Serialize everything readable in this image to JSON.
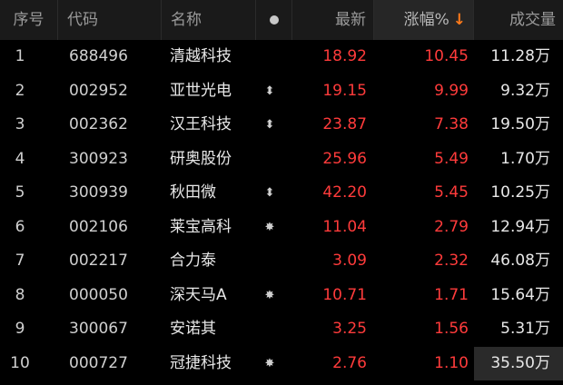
{
  "headers": {
    "index": "序号",
    "code": "代码",
    "name": "名称",
    "latest": "最新",
    "change_pct": "涨幅%",
    "volume": "成交量"
  },
  "colors": {
    "up": "#ff3b3b",
    "sort_arrow": "#ff7a1a",
    "header_bg": "#1a1a1a",
    "background": "#000000"
  },
  "rows": [
    {
      "index": "1",
      "code": "688496",
      "name": "清越科技",
      "mark": "",
      "latest": "18.92",
      "change_pct": "10.45",
      "volume": "11.28万"
    },
    {
      "index": "2",
      "code": "002952",
      "name": "亚世光电",
      "mark": "⬍",
      "latest": "19.15",
      "change_pct": "9.99",
      "volume": "9.32万"
    },
    {
      "index": "3",
      "code": "002362",
      "name": "汉王科技",
      "mark": "⬍",
      "latest": "23.87",
      "change_pct": "7.38",
      "volume": "19.50万"
    },
    {
      "index": "4",
      "code": "300923",
      "name": "研奥股份",
      "mark": "",
      "latest": "25.96",
      "change_pct": "5.49",
      "volume": "1.70万"
    },
    {
      "index": "5",
      "code": "300939",
      "name": "秋田微",
      "mark": "⬍",
      "latest": "42.20",
      "change_pct": "5.45",
      "volume": "10.25万"
    },
    {
      "index": "6",
      "code": "002106",
      "name": "莱宝高科",
      "mark": "✸",
      "latest": "11.04",
      "change_pct": "2.79",
      "volume": "12.94万"
    },
    {
      "index": "7",
      "code": "002217",
      "name": "合力泰",
      "mark": "",
      "latest": "3.09",
      "change_pct": "2.32",
      "volume": "46.08万"
    },
    {
      "index": "8",
      "code": "000050",
      "name": "深天马A",
      "mark": "✸",
      "latest": "10.71",
      "change_pct": "1.71",
      "volume": "15.64万"
    },
    {
      "index": "9",
      "code": "300067",
      "name": "安诺其",
      "mark": "",
      "latest": "3.25",
      "change_pct": "1.56",
      "volume": "5.31万"
    },
    {
      "index": "10",
      "code": "000727",
      "name": "冠捷科技",
      "mark": "✸",
      "latest": "2.76",
      "change_pct": "1.10",
      "volume": "35.50万"
    }
  ]
}
